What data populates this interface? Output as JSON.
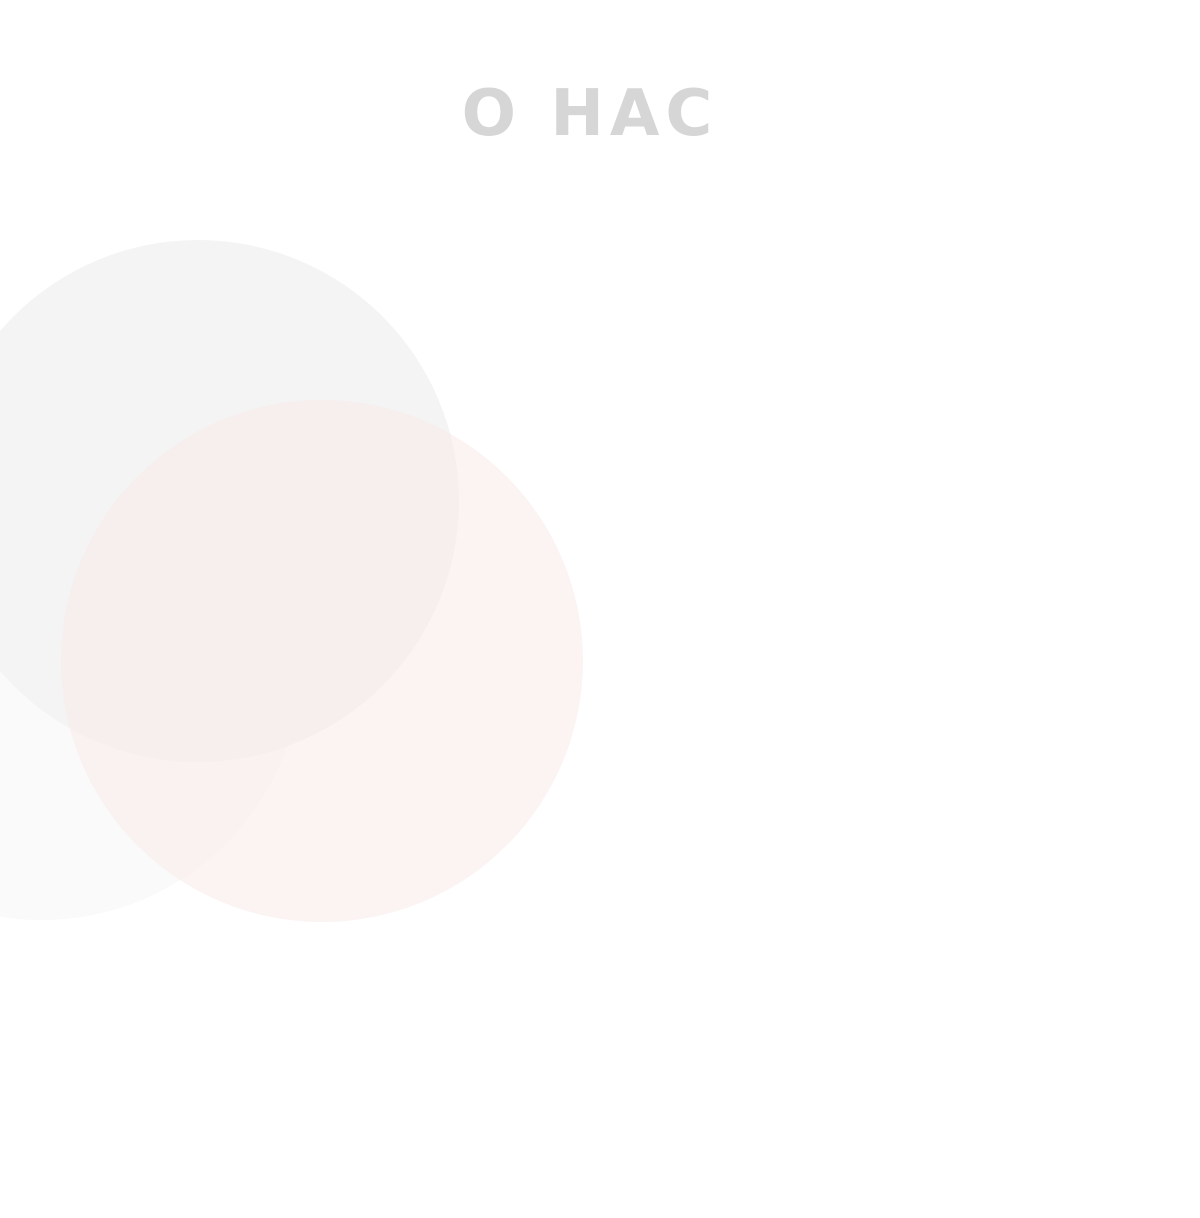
{
  "section": {
    "title": "О НАС"
  },
  "decor": {
    "circle_colors": [
      "#fafafa",
      "#f4f4f4",
      "#fdf2f2"
    ],
    "title_color": "#d6d6d6"
  }
}
